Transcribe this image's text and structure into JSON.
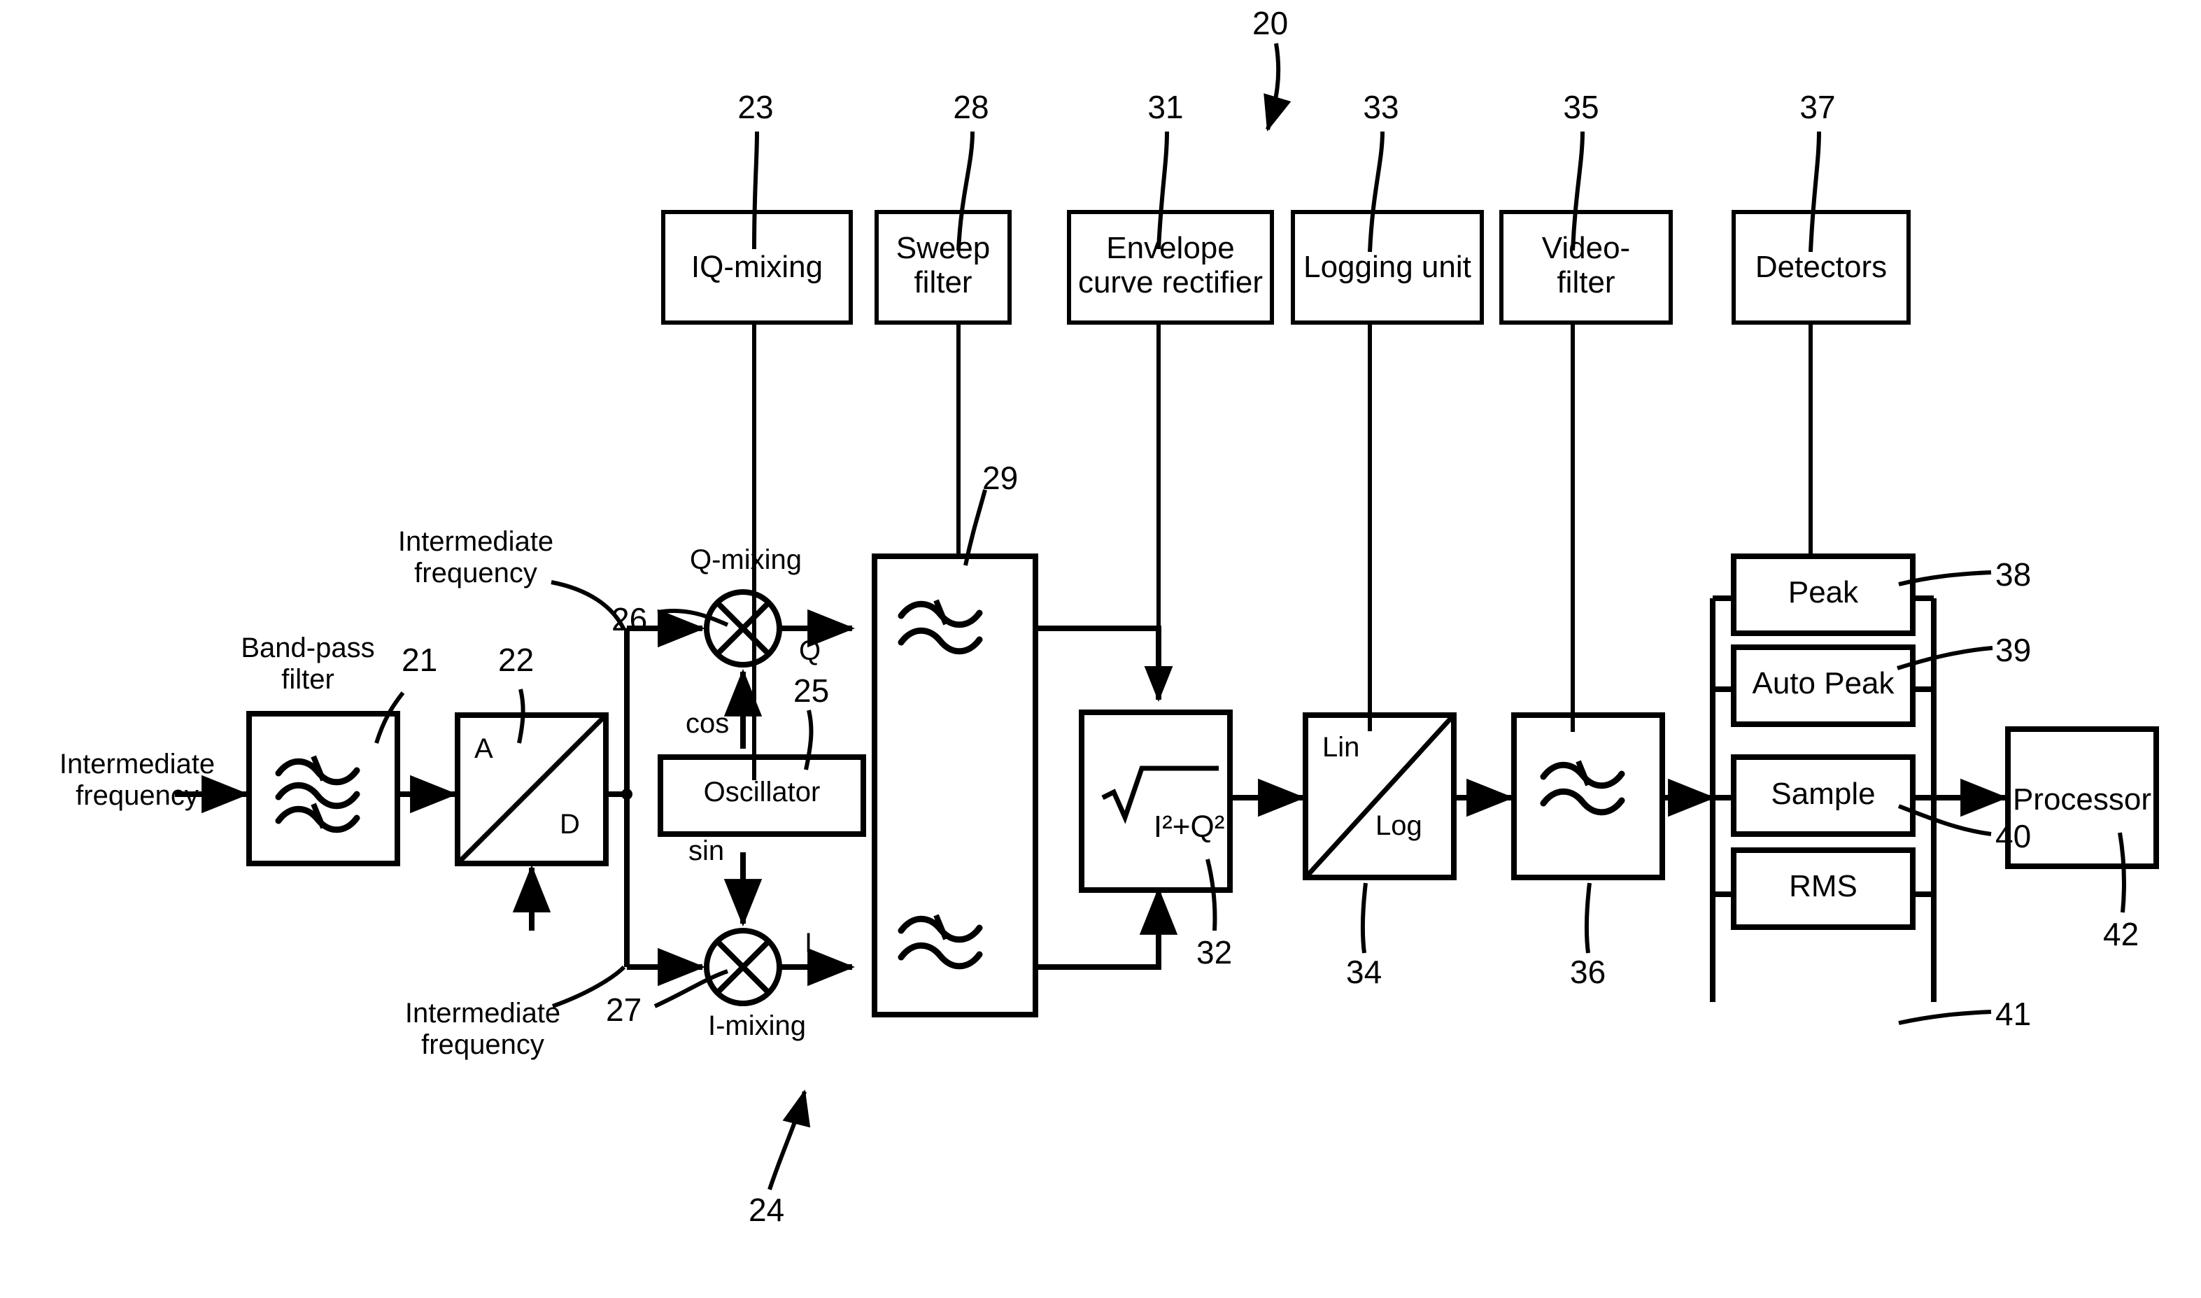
{
  "figure": {
    "overall_ref": "20",
    "kind": "patent-block-diagram"
  },
  "top_boxes": [
    {
      "label": "IQ-mixing",
      "ref": "23"
    },
    {
      "label": "Sweep\nfilter",
      "ref": "28"
    },
    {
      "label": "Envelope\ncurve rectifier",
      "ref": "31"
    },
    {
      "label": "Logging unit",
      "ref": "33"
    },
    {
      "label": "Video-\nfilter",
      "ref": "35"
    },
    {
      "label": "Detectors",
      "ref": "37"
    }
  ],
  "signal_path": {
    "input_label_1": "Intermediate\nfrequency",
    "bandpass": {
      "title": "Band-pass\nfilter",
      "ref": "21",
      "icon": "bandpass-filter-waves-icon"
    },
    "adc": {
      "analog_label": "A",
      "digital_label": "D",
      "ref": "22",
      "icon": "ad-converter-icon"
    },
    "if_label_upper": "Intermediate\nfrequency",
    "if_label_lower": "Intermediate\nfrequency",
    "q_mixer": {
      "title": "Q-mixing",
      "ref": "26",
      "output_label": "Q",
      "icon": "mixer-circle-cross-icon"
    },
    "i_mixer": {
      "title": "I-mixing",
      "ref": "27",
      "output_label": "I",
      "icon": "mixer-circle-cross-icon"
    },
    "iq_group_ref": "24",
    "oscillator": {
      "label": "Oscillator",
      "ref": "25",
      "cos_label": "cos",
      "sin_label": "sin"
    },
    "sweep_filter": {
      "ref": "29",
      "icon": "sweep-filter-waves-icon"
    },
    "rectifier": {
      "formula": "I²+Q²",
      "ref": "32",
      "icon": "sqrt-icon"
    },
    "linlog": {
      "lin_label": "Lin",
      "log_label": "Log",
      "ref": "34",
      "icon": "lin-log-converter-icon"
    },
    "video_filter": {
      "ref": "36",
      "icon": "video-filter-waves-icon"
    },
    "processor": {
      "label": "Processor",
      "ref": "42"
    }
  },
  "detectors": [
    {
      "label": "Peak",
      "ref": "38"
    },
    {
      "label": "Auto Peak",
      "ref": "39"
    },
    {
      "label": "Sample",
      "ref": "40"
    },
    {
      "label": "RMS",
      "ref": "41"
    }
  ],
  "colors": {
    "ink": "#000000",
    "paper": "#ffffff"
  }
}
